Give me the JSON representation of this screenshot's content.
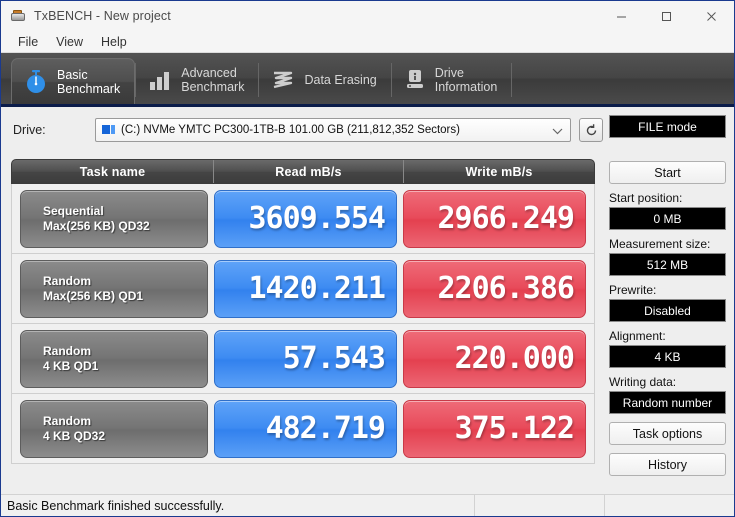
{
  "window": {
    "title": "TxBENCH - New project",
    "icon": "drive-icon",
    "controls": {
      "minimize": "minimize-icon",
      "maximize": "maximize-icon",
      "close": "close-icon"
    }
  },
  "menubar": {
    "items": [
      {
        "label": "File"
      },
      {
        "label": "View"
      },
      {
        "label": "Help"
      }
    ]
  },
  "tabs": [
    {
      "label": "Basic\nBenchmark",
      "icon": "stopwatch-icon",
      "active": true
    },
    {
      "label": "Advanced\nBenchmark",
      "icon": "bar-chart-icon",
      "active": false
    },
    {
      "label": "Data Erasing",
      "icon": "shred-icon",
      "active": false
    },
    {
      "label": "Drive\nInformation",
      "icon": "drive-info-icon",
      "active": false
    }
  ],
  "drive": {
    "label": "Drive:",
    "value": "(C:) NVMe YMTC PC300-1TB-B  101.00 GB (211,812,352 Sectors)",
    "icon": "drive-small-icon",
    "dropdown_icon": "chevron-down-icon",
    "refresh_icon": "refresh-icon"
  },
  "table": {
    "headers": {
      "task": "Task name",
      "read": "Read mB/s",
      "write": "Write mB/s"
    },
    "rows": [
      {
        "task_line1": "Sequential",
        "task_line2": "Max(256 KB) QD32",
        "read": "3609.554",
        "write": "2966.249"
      },
      {
        "task_line1": "Random",
        "task_line2": "Max(256 KB) QD1",
        "read": "1420.211",
        "write": "2206.386"
      },
      {
        "task_line1": "Random",
        "task_line2": "4 KB QD1",
        "read": "57.543",
        "write": "220.000"
      },
      {
        "task_line1": "Random",
        "task_line2": "4 KB QD32",
        "read": "482.719",
        "write": "375.122"
      }
    ]
  },
  "panel": {
    "mode_button": "FILE mode",
    "start_button": "Start",
    "start_position_label": "Start position:",
    "start_position_value": "0 MB",
    "measurement_size_label": "Measurement size:",
    "measurement_size_value": "512 MB",
    "prewrite_label": "Prewrite:",
    "prewrite_value": "Disabled",
    "alignment_label": "Alignment:",
    "alignment_value": "4 KB",
    "writing_data_label": "Writing data:",
    "writing_data_value": "Random number",
    "task_options_button": "Task options",
    "history_button": "History"
  },
  "statusbar": {
    "message": "Basic Benchmark finished successfully."
  },
  "colors": {
    "read_blue": "#3d8bf2",
    "write_red": "#e84a5a",
    "tabstrip_dark": "#454545",
    "accent_border": "#1a3a8f",
    "app_background": "#eeeeee"
  }
}
